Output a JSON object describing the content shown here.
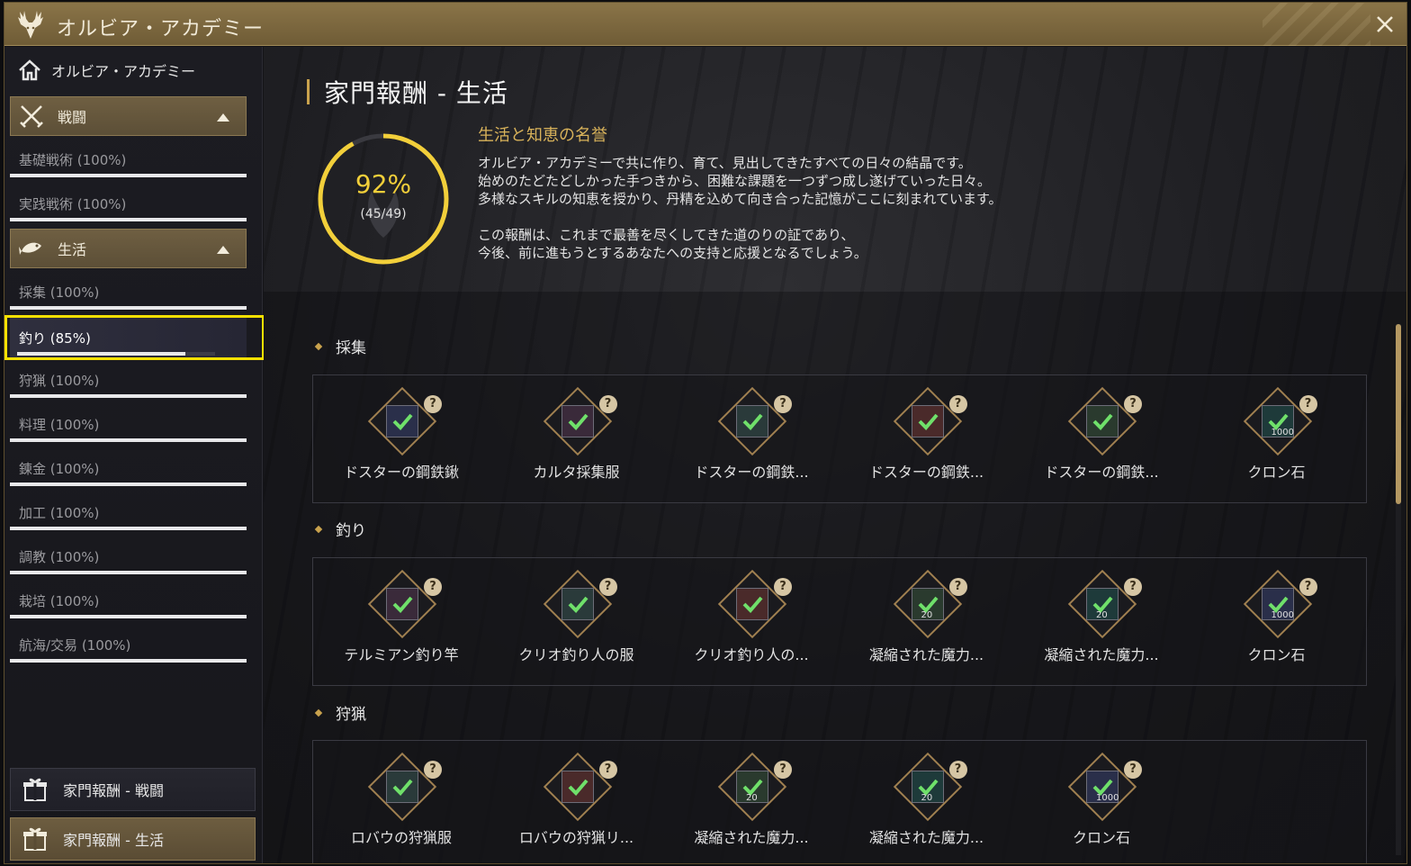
{
  "window": {
    "title": "オルビア・アカデミー"
  },
  "sidebar": {
    "home_label": "オルビア・アカデミー",
    "categories": [
      {
        "label": "戦闘",
        "expanded": true,
        "items": [
          {
            "label": "基礎戦術 (100%)",
            "progress": 1.0
          },
          {
            "label": "実践戦術 (100%)",
            "progress": 1.0
          }
        ]
      },
      {
        "label": "生活",
        "expanded": true,
        "items": [
          {
            "label": "採集 (100%)",
            "progress": 1.0
          },
          {
            "label": "釣り (85%)",
            "progress": 0.85,
            "active": true
          },
          {
            "label": "狩猟 (100%)",
            "progress": 1.0
          },
          {
            "label": "料理 (100%)",
            "progress": 1.0
          },
          {
            "label": "錬金 (100%)",
            "progress": 1.0
          },
          {
            "label": "加工 (100%)",
            "progress": 1.0
          },
          {
            "label": "調教 (100%)",
            "progress": 1.0
          },
          {
            "label": "栽培 (100%)",
            "progress": 1.0
          },
          {
            "label": "航海/交易 (100%)",
            "progress": 1.0
          }
        ]
      }
    ],
    "bottom_buttons": [
      {
        "label": "家門報酬 - 戦闘"
      },
      {
        "label": "家門報酬 - 生活",
        "active": true
      }
    ]
  },
  "main": {
    "title": "家門報酬 - 生活",
    "progress": {
      "percent_label": "92%",
      "count_label": "(45/49)",
      "value": 0.92
    },
    "subtitle": "生活と知恵の名誉",
    "description": [
      "オルビア・アカデミーで共に作り、育て、見出してきたすべての日々の結晶です。",
      "始めのたどたどしかった手つきから、困難な課題を一つずつ成し遂げていった日々。",
      "多様なスキルの知恵を授かり、丹精を込めて向き合った記憶がここに刻まれています。",
      "",
      "この報酬は、これまで最善を尽くしてきた道のりの証であり、",
      "今後、前に進もうとするあなたへの支持と応援となるでしょう。"
    ],
    "sections": [
      {
        "title": "採集",
        "rewards": [
          {
            "name": "ドスターの鋼鉄鍬",
            "qty": ""
          },
          {
            "name": "カルタ採集服",
            "qty": ""
          },
          {
            "name": "ドスターの鋼鉄...",
            "qty": ""
          },
          {
            "name": "ドスターの鋼鉄...",
            "qty": ""
          },
          {
            "name": "ドスターの鋼鉄...",
            "qty": ""
          },
          {
            "name": "クロン石",
            "qty": "1000"
          }
        ]
      },
      {
        "title": "釣り",
        "rewards": [
          {
            "name": "テルミアン釣り竿",
            "qty": ""
          },
          {
            "name": "クリオ釣り人の服",
            "qty": ""
          },
          {
            "name": "クリオ釣り人の...",
            "qty": ""
          },
          {
            "name": "凝縮された魔力...",
            "qty": "20"
          },
          {
            "name": "凝縮された魔力...",
            "qty": "20"
          },
          {
            "name": "クロン石",
            "qty": "1000"
          }
        ]
      },
      {
        "title": "狩猟",
        "rewards": [
          {
            "name": "ロバウの狩猟服",
            "qty": ""
          },
          {
            "name": "ロバウの狩猟リ...",
            "qty": ""
          },
          {
            "name": "凝縮された魔力...",
            "qty": "20"
          },
          {
            "name": "凝縮された魔力...",
            "qty": "20"
          },
          {
            "name": "クロン石",
            "qty": "1000"
          }
        ]
      }
    ],
    "question_mark": "?"
  },
  "colors": {
    "accent_gold": "#c9a24d",
    "progress_yellow": "#f2cf3a",
    "highlight": "#f5e000",
    "check_green": "#6fe06a"
  }
}
